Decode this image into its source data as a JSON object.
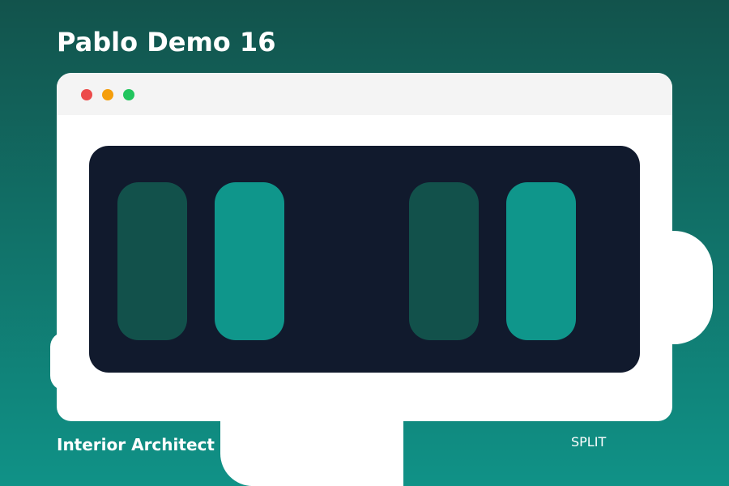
{
  "page": {
    "title": "Pablo Demo 16",
    "subtitle": "Interior Architect",
    "mode_badge": "SPLIT"
  },
  "window": {
    "controls": [
      {
        "name": "close-dot-icon",
        "color": "#ec4b4b"
      },
      {
        "name": "minimize-dot-icon",
        "color": "#f59e0b"
      },
      {
        "name": "maximize-dot-icon",
        "color": "#22c55e"
      }
    ]
  },
  "colors": {
    "background_top": "#12534c",
    "background_bottom": "#109287",
    "canvas": "#111a2d",
    "panel_dark": "#12514b",
    "panel_light": "#0f968b",
    "window": "#ffffff",
    "titlebar": "#f4f4f4"
  },
  "panels": [
    {
      "name": "panel-1",
      "tone": "dark"
    },
    {
      "name": "panel-2",
      "tone": "light"
    },
    {
      "name": "panel-3",
      "tone": "dark"
    },
    {
      "name": "panel-4",
      "tone": "light"
    }
  ]
}
